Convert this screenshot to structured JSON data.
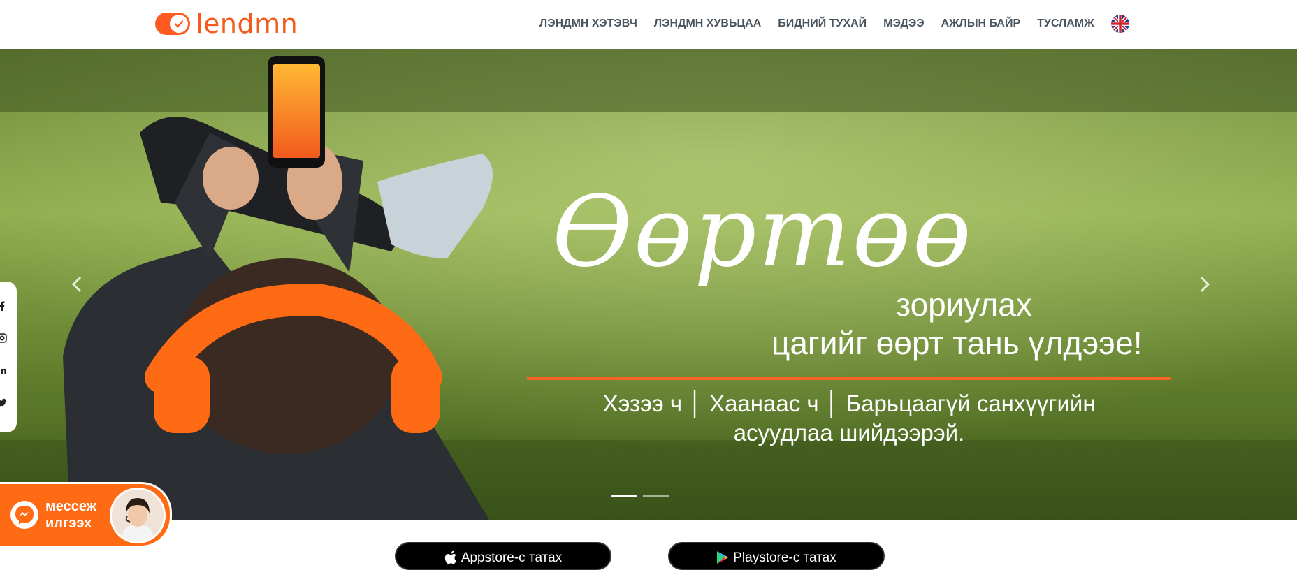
{
  "brand": {
    "name": "lendmn",
    "accent": "#f45a1c"
  },
  "nav": {
    "items": [
      "ЛЭНДМН ХЭТЭВЧ",
      "ЛЭНДМН ХУВЬЦАА",
      "БИДНИЙ ТУХАЙ",
      "МЭДЭЭ",
      "АЖЛЫН БАЙР",
      "ТУСЛАМЖ"
    ],
    "language_icon": "uk-flag-icon"
  },
  "hero": {
    "script_word": "Өөртөө",
    "line1": "зориулах",
    "line2": "цагийг өөрт тань үлдээе!",
    "sub1": "Хэзээ ч │ Хаанаас ч │ Барьцаагүй санхүүгийн",
    "sub2": "асуудлаа шийдээрэй.",
    "rule_color": "#f26522",
    "slide_count": 2,
    "active_slide": 1
  },
  "messenger": {
    "label_line1": "мессеж",
    "label_line2": "илгээх",
    "color": "#ff6a14"
  },
  "stores": {
    "appstore_label": "Appstore-с татах",
    "playstore_label": "Playstore-с татах"
  }
}
